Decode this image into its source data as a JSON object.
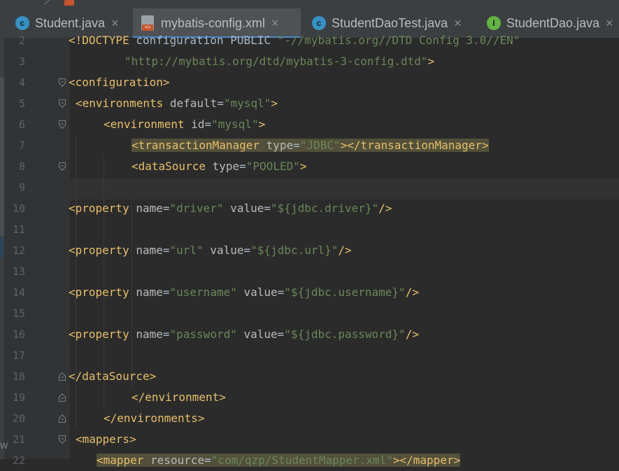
{
  "tabs": [
    {
      "label": "Student.java",
      "icon": "java-class-icon",
      "icon_letter": "c",
      "icon_color": "#3592c4",
      "active": false
    },
    {
      "label": "mybatis-config.xml",
      "icon": "xml-file-icon",
      "active": true
    },
    {
      "label": "StudentDaoTest.java",
      "icon": "java-test-class-icon",
      "icon_letter": "c",
      "icon_color": "#3592c4",
      "active": false
    },
    {
      "label": "StudentDao.java",
      "icon": "java-interface-icon",
      "icon_letter": "I",
      "icon_color": "#62b543",
      "active": false
    }
  ],
  "close_glyph": "×",
  "colors": {
    "tag": "#e8bf6a",
    "attribute": "#bababa",
    "value": "#6a8759",
    "text": "#a9b7c6",
    "line_number": "#606366",
    "active_tab_underline": "#4a88c7"
  },
  "lines": [
    {
      "n": "2",
      "text": "<!DOCTYPE configuration PUBLIC \"-//mybatis.org//DTD Config 3.0//EN\""
    },
    {
      "n": "3",
      "text": "\"http://mybatis.org/dtd/mybatis-3-config.dtd\">"
    },
    {
      "n": "4",
      "text": "<configuration>"
    },
    {
      "n": "5",
      "text": "<environments default=\"mysql\">"
    },
    {
      "n": "6",
      "text": "<environment id=\"mysql\">"
    },
    {
      "n": "7",
      "text": "<transactionManager type=\"JDBC\"></transactionManager>"
    },
    {
      "n": "8",
      "text": "<dataSource type=\"POOLED\">"
    },
    {
      "n": "9",
      "text": ""
    },
    {
      "n": "10",
      "text": "<property name=\"driver\" value=\"${jdbc.driver}\"/>"
    },
    {
      "n": "11",
      "text": ""
    },
    {
      "n": "12",
      "text": "<property name=\"url\" value=\"${jdbc.url}\"/>"
    },
    {
      "n": "13",
      "text": ""
    },
    {
      "n": "14",
      "text": "<property name=\"username\" value=\"${jdbc.username}\"/>"
    },
    {
      "n": "15",
      "text": ""
    },
    {
      "n": "16",
      "text": "<property name=\"password\" value=\"${jdbc.password}\"/>"
    },
    {
      "n": "17",
      "text": ""
    },
    {
      "n": "18",
      "text": "</dataSource>"
    },
    {
      "n": "19",
      "text": "</environment>"
    },
    {
      "n": "20",
      "text": "</environments>"
    },
    {
      "n": "21",
      "text": "<mappers>"
    },
    {
      "n": "22",
      "text": "<mapper resource=\"com/qzp/StudentMapper.xml\"></mapper>"
    }
  ],
  "edge_glyph": "W"
}
